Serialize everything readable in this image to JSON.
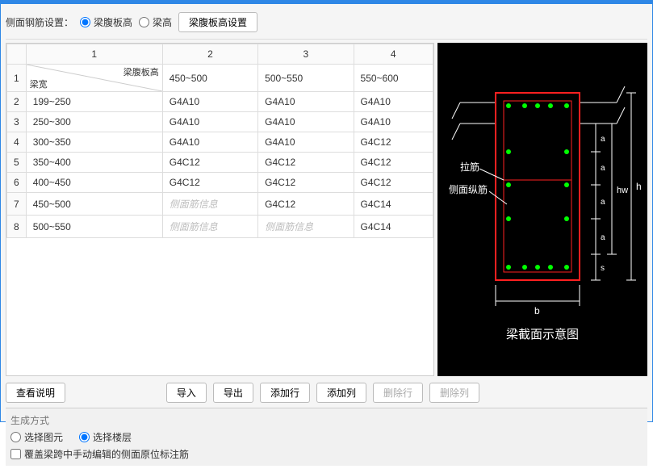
{
  "title": " ",
  "settings": {
    "label": "侧面钢筋设置：",
    "opt1": "梁腹板高",
    "opt2": "梁高",
    "configBtn": "梁腹板高设置"
  },
  "table": {
    "cornerTop": "梁腹板高",
    "cornerBottom": "梁宽",
    "colHeaders": [
      "1",
      "2",
      "3",
      "4"
    ],
    "topRow": [
      "450~500",
      "500~550",
      "550~600"
    ],
    "rows": [
      {
        "n": "2",
        "h": "199~250",
        "c": [
          "G4A10",
          "G4A10",
          "G4A10"
        ]
      },
      {
        "n": "3",
        "h": "250~300",
        "c": [
          "G4A10",
          "G4A10",
          "G4A10"
        ]
      },
      {
        "n": "4",
        "h": "300~350",
        "c": [
          "G4A10",
          "G4A10",
          "G4C12"
        ]
      },
      {
        "n": "5",
        "h": "350~400",
        "c": [
          "G4C12",
          "G4C12",
          "G4C12"
        ]
      },
      {
        "n": "6",
        "h": "400~450",
        "c": [
          "G4C12",
          "G4C12",
          "G4C12"
        ]
      },
      {
        "n": "7",
        "h": "450~500",
        "c": [
          "侧面筋信息",
          "G4C12",
          "G4C14"
        ],
        "ph": [
          true,
          false,
          false
        ]
      },
      {
        "n": "8",
        "h": "500~550",
        "c": [
          "侧面筋信息",
          "侧面筋信息",
          "G4C14"
        ],
        "ph": [
          true,
          true,
          false
        ]
      }
    ]
  },
  "diagram": {
    "label_tie": "拉筋",
    "label_side": "侧面纵筋",
    "dim_b": "b",
    "dim_h": "h",
    "dim_hw": "hw",
    "dim_a": "a",
    "dim_s": "s",
    "caption": "梁截面示意图"
  },
  "toolbar": {
    "explain": "查看说明",
    "import": "导入",
    "export": "导出",
    "addRow": "添加行",
    "addCol": "添加列",
    "delRow": "删除行",
    "delCol": "删除列"
  },
  "gen": {
    "title": "生成方式",
    "opt1": "选择图元",
    "opt2": "选择楼层",
    "chk": "覆盖梁跨中手动编辑的侧面原位标注筋"
  }
}
